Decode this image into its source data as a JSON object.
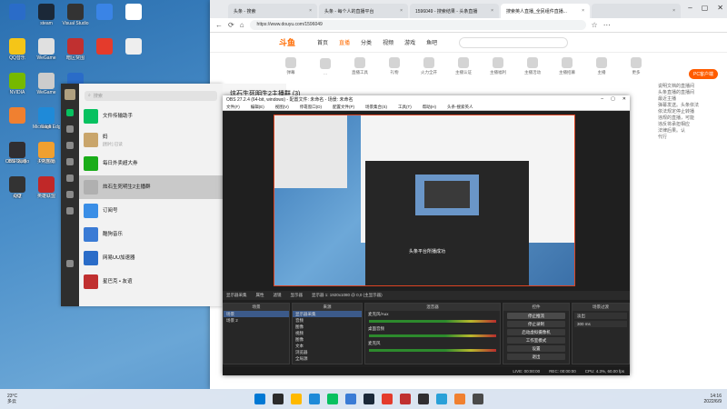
{
  "desktop_icons": [
    {
      "label": "",
      "color": "#2a6cc8"
    },
    {
      "label": "steam",
      "color": "#1b2838"
    },
    {
      "label": "Visual Studio",
      "color": "#333"
    },
    {
      "label": "",
      "color": "#3a84e6"
    },
    {
      "label": "",
      "color": "#fff"
    },
    {
      "label": "QQ音乐",
      "color": "#f5c518"
    },
    {
      "label": "WeGame",
      "color": "#e0e0e0"
    },
    {
      "label": "暗区突围",
      "color": "#c03030"
    },
    {
      "label": "",
      "color": "#e43b2c"
    },
    {
      "label": "",
      "color": "#eee"
    },
    {
      "label": "",
      "color": "#3a7bd5"
    },
    {
      "label": "",
      "color": "#f5c542"
    },
    {
      "label": "NVIDIA",
      "color": "#76b900"
    },
    {
      "label": "WeGame",
      "color": "#ccc"
    },
    {
      "label": "logo",
      "color": "#2a6cc8"
    },
    {
      "label": "",
      "color": "#3f6fd8"
    },
    {
      "label": "Edge",
      "color": "#2aa0d8"
    },
    {
      "label": "",
      "color": "#f08030"
    },
    {
      "label": "Microsoft Edge",
      "color": "#1f8ad8"
    },
    {
      "label": "头条搜索",
      "color": "#e43b2c"
    },
    {
      "label": "DNF攻略",
      "color": "#b03030"
    },
    {
      "label": "头条直播",
      "color": "#e44b2c"
    },
    {
      "label": "OBS Studio",
      "color": "#302e31"
    },
    {
      "label": "PP游戏",
      "color": "#f0a030"
    },
    {
      "label": "WPS Office",
      "color": "#d03030"
    },
    {
      "label": "百度",
      "color": "#3070e0"
    },
    {
      "label": "英雄联盟",
      "color": "#c02828"
    },
    {
      "label": "QQ",
      "color": "#333"
    }
  ],
  "browser": {
    "tabs": [
      {
        "label": "头条 - 搜索",
        "active": false
      },
      {
        "label": "头条 - 每个人的直播平台",
        "active": false
      },
      {
        "label": "1596049 - 搜索结果 - 头条直播",
        "active": false
      },
      {
        "label": "搜索英人直播_全民组件直播...",
        "active": true
      },
      {
        "label": "",
        "active": false
      }
    ],
    "url": "https://www.douyu.com/1596049",
    "nav": [
      "首页",
      "直播",
      "分类",
      "视频",
      "游戏",
      "鱼吧"
    ],
    "active_nav": "直播",
    "bar_icons": [
      "弹幕",
      "...",
      "直播工具",
      "礼物",
      "火力全开",
      "主播认证",
      "主播福利",
      "主播活动",
      "主播招募",
      "主播",
      "更多"
    ],
    "pc_button": "PC客户端",
    "right_text": [
      "说明文档的直播间",
      "头条直播的直播间",
      "最近主播",
      "弹幕发送。头条依法",
      "依法规定停止转播",
      "违规的直播，可能",
      "违反将承担相应",
      "法律后果。认",
      "代行"
    ]
  },
  "wechat": {
    "search_placeholder": "搜索",
    "chat_title": "炫石生死明生2主播群 (3)",
    "items": [
      {
        "name": "文件传输助手",
        "preview": "",
        "time": "",
        "color": "#07c160",
        "selected": false
      },
      {
        "name": "妈",
        "preview": "[图片] 已读",
        "time": "",
        "color": "#c9a56b",
        "selected": false
      },
      {
        "name": "每日外卖超大券",
        "preview": "",
        "time": "",
        "color": "#1aad19",
        "selected": false
      },
      {
        "name": "炫石生死明生2主播群",
        "preview": "",
        "time": "",
        "color": "#b0b0b0",
        "selected": true
      },
      {
        "name": "订阅号",
        "preview": "",
        "time": "",
        "color": "#3a8ee6",
        "selected": false
      },
      {
        "name": "酷狗音乐",
        "preview": "",
        "time": "",
        "color": "#3a7bd5",
        "selected": false
      },
      {
        "name": "网易UU加速器",
        "preview": "",
        "time": "",
        "color": "#2a6cc8",
        "selected": false
      },
      {
        "name": "星巴克 • 友谊",
        "preview": "",
        "time": "",
        "color": "#c03030",
        "selected": false
      }
    ]
  },
  "obs": {
    "title": "OBS 27.2.4 (64-bit, windows) - 配置文件: 未命名 - 场景: 未命名",
    "menu": [
      "文件(F)",
      "编辑(E)",
      "视图(V)",
      "停靠窗口(D)",
      "配置文件(P)",
      "场景集合(S)",
      "工具(T)",
      "帮助(H)",
      "头条-搜索英人"
    ],
    "preview_caption": "头条平台所播成功",
    "src_toolbar": [
      "显示器采集",
      "属性",
      "滤镜",
      "显示器",
      "显示器 1: 1920x1080 @ 0,0 (主显示器)"
    ],
    "scenes_header": "场景",
    "scenes": [
      "场景",
      "场景 2"
    ],
    "sources_header": "来源",
    "sources": [
      "显示器采集",
      "音频",
      "图像",
      "视频",
      "图像",
      "文本",
      "浏览器",
      "全局源"
    ],
    "mixer_header": "混音器",
    "mixer": [
      "麦克风/Aux",
      "桌面音频",
      "麦克风"
    ],
    "transitions_header": "场景过渡",
    "transition": "淡出",
    "transition_duration": "300 ms",
    "controls_header": "控件",
    "controls": [
      "停止推流",
      "停止录制",
      "启动虚拟摄像机",
      "工作室模式",
      "设置",
      "退出"
    ],
    "status": [
      "LIVE: 00:00:00",
      "REC: 00:00:00",
      "CPU: 4.3%, 60.00 fps"
    ]
  },
  "taskbar": {
    "weather": "23°C",
    "weather_desc": "多云",
    "clock": "14:16",
    "date": "2022/6/9",
    "icons": [
      "#0078d4",
      "#2b2b2b",
      "#ffb900",
      "#1f8ad8",
      "#07c160",
      "#3a7bd5",
      "#1b2838",
      "#e43b2c",
      "#c03030",
      "#302e31",
      "#2aa0d8",
      "#f08030",
      "#4a4a4a"
    ]
  }
}
